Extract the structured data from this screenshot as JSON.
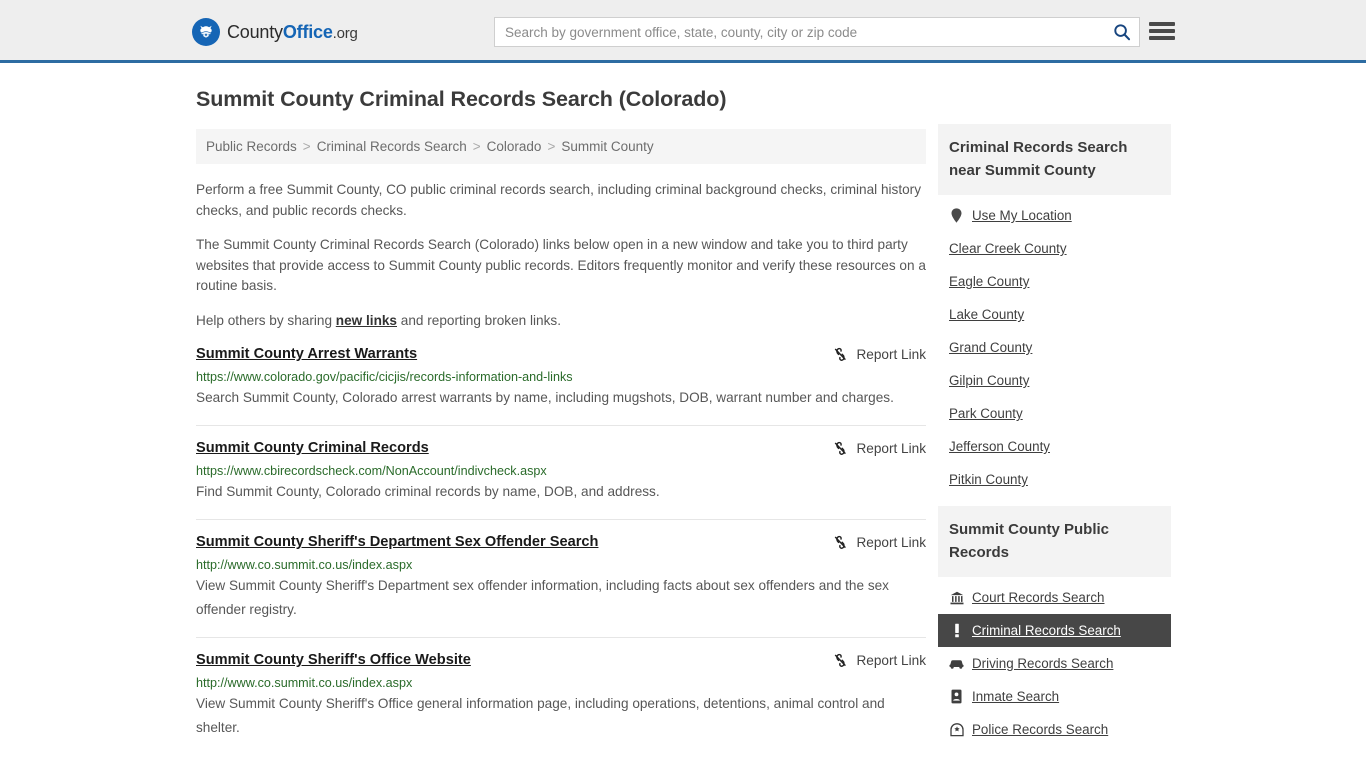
{
  "header": {
    "logo": {
      "icon": "eagle-seal-icon",
      "part1": "County",
      "part2": "Office",
      "part3": ".org"
    },
    "search": {
      "placeholder": "Search by government office, state, county, city or zip code",
      "value": "",
      "button_icon": "search-icon"
    },
    "menu_icon": "hamburger-menu-icon",
    "accent_color": "#2d6ca2"
  },
  "main": {
    "title": "Summit County Criminal Records Search (Colorado)",
    "breadcrumb": [
      "Public Records",
      "Criminal Records Search",
      "Colorado",
      "Summit County"
    ],
    "breadcrumb_separator": ">",
    "intro": {
      "p1": "Perform a free Summit County, CO public criminal records search, including criminal background checks, criminal history checks, and public records checks.",
      "p2": "The Summit County Criminal Records Search (Colorado) links below open in a new window and take you to third party websites that provide access to Summit County public records. Editors frequently monitor and verify these resources on a routine basis.",
      "p3_before": "Help others by sharing ",
      "p3_link": "new links",
      "p3_after": " and reporting broken links."
    },
    "report_link_label": "Report Link",
    "report_link_icon": "broken-link-icon",
    "results": [
      {
        "title": "Summit County Arrest Warrants",
        "url": "https://www.colorado.gov/pacific/cicjis/records-information-and-links",
        "description": "Search Summit County, Colorado arrest warrants by name, including mugshots, DOB, warrant number and charges."
      },
      {
        "title": "Summit County Criminal Records",
        "url": "https://www.cbirecordscheck.com/NonAccount/indivcheck.aspx",
        "description": "Find Summit County, Colorado criminal records by name, DOB, and address."
      },
      {
        "title": "Summit County Sheriff's Department Sex Offender Search",
        "url": "http://www.co.summit.co.us/index.aspx",
        "description": "View Summit County Sheriff's Department sex offender information, including facts about sex offenders and the sex offender registry."
      },
      {
        "title": "Summit County Sheriff's Office Website",
        "url": "http://www.co.summit.co.us/index.aspx",
        "description": "View Summit County Sheriff's Office general information page, including operations, detentions, animal control and shelter."
      }
    ]
  },
  "sidebar": {
    "nearby": {
      "heading": "Criminal Records Search near Summit County",
      "items": [
        {
          "label": "Use My Location",
          "icon": "map-pin-icon"
        },
        {
          "label": "Clear Creek County",
          "icon": ""
        },
        {
          "label": "Eagle County",
          "icon": ""
        },
        {
          "label": "Lake County",
          "icon": ""
        },
        {
          "label": "Grand County",
          "icon": ""
        },
        {
          "label": "Gilpin County",
          "icon": ""
        },
        {
          "label": "Park County",
          "icon": ""
        },
        {
          "label": "Jefferson County",
          "icon": ""
        },
        {
          "label": "Pitkin County",
          "icon": ""
        }
      ]
    },
    "public_records": {
      "heading": "Summit County Public Records",
      "active_label": "Criminal Records Search",
      "active_bg": "#474747",
      "items": [
        {
          "label": "Court Records Search",
          "icon": "courthouse-icon",
          "active": false
        },
        {
          "label": "Criminal Records Search",
          "icon": "exclamation-icon",
          "active": true
        },
        {
          "label": "Driving Records Search",
          "icon": "car-icon",
          "active": false
        },
        {
          "label": "Inmate Search",
          "icon": "id-badge-icon",
          "active": false
        },
        {
          "label": "Police Records Search",
          "icon": "police-badge-icon",
          "active": false
        }
      ]
    }
  }
}
